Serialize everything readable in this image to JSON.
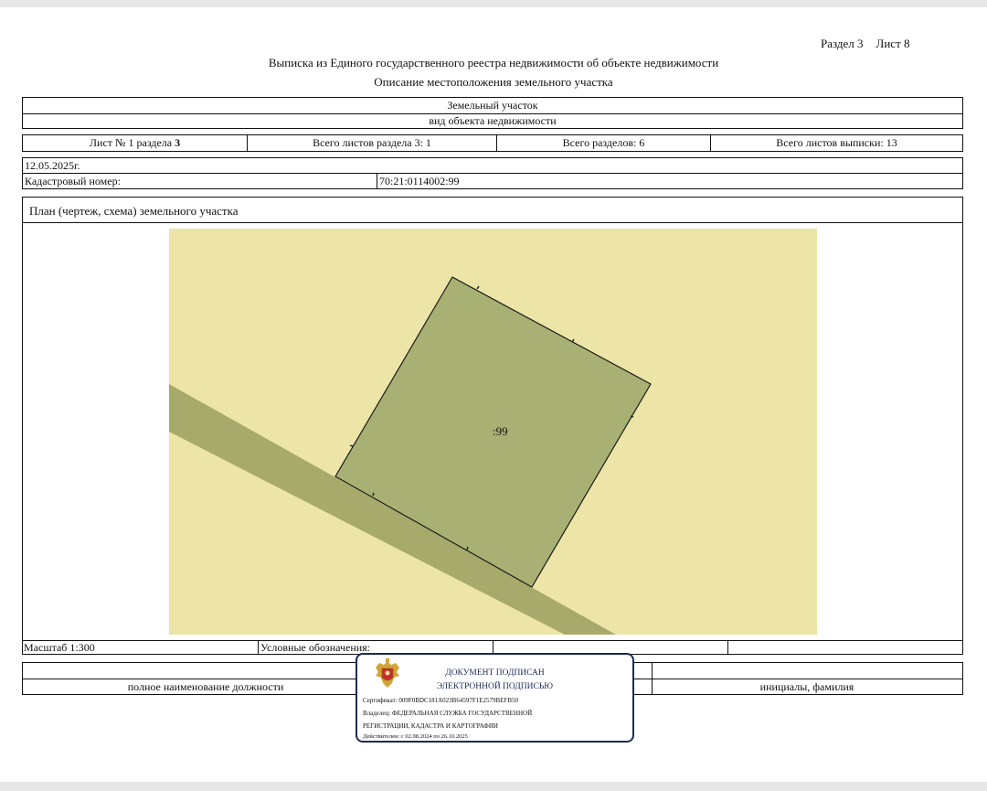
{
  "header": {
    "section": "Раздел 3",
    "sheet": "Лист 8",
    "title": "Выписка из Единого государственного реестра недвижимости об объекте недвижимости",
    "subtitle": "Описание местоположения земельного участка"
  },
  "object": {
    "type_value": "Земельный участок",
    "type_caption": "вид объекта недвижимости"
  },
  "sheets": {
    "sheet_no_prefix": "Лист № 1 раздела ",
    "sheet_no_bold": "3",
    "total_section_sheets": "Всего листов раздела 3: 1",
    "total_sections": "Всего разделов: 6",
    "total_extract_sheets": "Всего листов выписки: 13"
  },
  "info": {
    "date": "12.05.2025г.",
    "cadastral_label": "Кадастровый номер:",
    "cadastral_number": "70:21:0114002:99"
  },
  "plan": {
    "heading": "План (чертеж, схема) земельного участка",
    "parcel_label": ":99",
    "colors": {
      "background": "#ece5a7",
      "parcel": "#a8b173",
      "road": "#a8aa6c",
      "border": "#1a1a1a"
    }
  },
  "footer": {
    "scale": "Масштаб 1:300",
    "legend": "Условные обозначения:",
    "position_caption": "полное наименование должности",
    "name_caption": "инициалы, фамилия"
  },
  "signature": {
    "emblem_icon": "coat-of-arms",
    "line1": "ДОКУМЕНТ ПОДПИСАН",
    "line2": "ЭЛЕКТРОННОЙ ПОДПИСЬЮ",
    "certificate": "Сертификат: 009F0BDC181A023B64597F1E2579BEFB50",
    "owner1": "Владелец: ФЕДЕРАЛЬНАЯ СЛУЖБА ГОСУДАРСТВЕННОЙ",
    "owner2": "РЕГИСТРАЦИИ, КАДАСТРА И КАРТОГРАФИИ",
    "valid": "Действителен: с 02.08.2024 по 26.10.2025"
  }
}
